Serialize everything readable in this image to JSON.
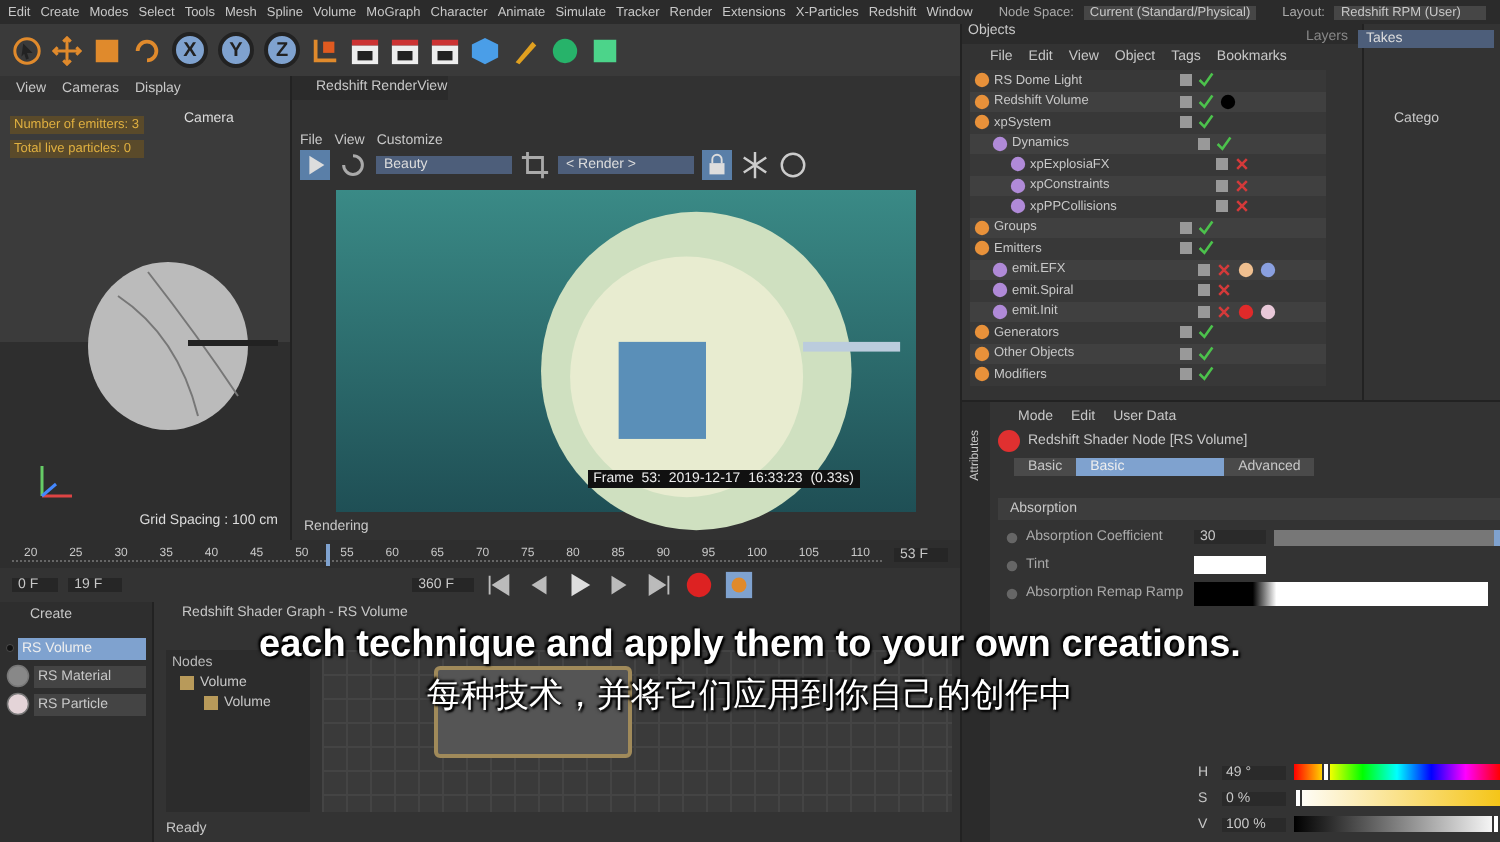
{
  "menubar": {
    "items": [
      "Edit",
      "Create",
      "Modes",
      "Select",
      "Tools",
      "Mesh",
      "Spline",
      "Volume",
      "MoGraph",
      "Character",
      "Animate",
      "Simulate",
      "Tracker",
      "Render",
      "Extensions",
      "X-Particles",
      "Redshift",
      "Window"
    ],
    "node_space_label": "Node Space:",
    "node_space_value": "Current (Standard/Physical)",
    "layout_label": "Layout:",
    "layout_value": "Redshift RPM (User)"
  },
  "toolbar": {
    "axis_buttons": [
      {
        "label": "X",
        "on": true
      },
      {
        "label": "Y",
        "on": true
      },
      {
        "label": "Z",
        "on": true
      }
    ]
  },
  "viewport": {
    "menu": [
      "View",
      "Cameras",
      "Display"
    ],
    "hud": [
      "Number of emitters: 3",
      "Total live particles: 0"
    ],
    "camera_label": "Camera",
    "grid_spacing": "Grid Spacing : 100 cm"
  },
  "render_view": {
    "title": "Redshift RenderView",
    "menu": [
      "File",
      "View",
      "Customize"
    ],
    "aov": "Beauty",
    "camera": "< Render >",
    "frame_info": "Frame  53:  2019-12-17  16:33:23  (0.33s)",
    "status": "Rendering"
  },
  "timeline": {
    "ticks": [
      "20",
      "25",
      "30",
      "35",
      "40",
      "45",
      "50",
      "55",
      "60",
      "65",
      "70",
      "75",
      "80",
      "85",
      "90",
      "95",
      "100",
      "105",
      "110"
    ],
    "playhead": {
      "level": 0.36
    },
    "current_frame": "53 F",
    "start": "0 F",
    "current": "19 F",
    "end": "360 F"
  },
  "create_panel": {
    "title": "Create",
    "items": [
      {
        "label": "RS Volume",
        "selected": true
      },
      {
        "label": "RS Material",
        "selected": false
      },
      {
        "label": "RS Particle",
        "selected": false
      }
    ]
  },
  "shader_graph": {
    "title": "Redshift Shader Graph - RS Volume",
    "nodes_title": "Nodes",
    "tree": [
      {
        "label": "Volume",
        "children": [
          {
            "label": "Volume"
          }
        ]
      }
    ],
    "status": "Ready"
  },
  "objects": {
    "title": "Objects",
    "menu": [
      "File",
      "Edit",
      "View",
      "Object",
      "Tags",
      "Bookmarks"
    ],
    "tree": [
      {
        "label": "RS Dome Light",
        "enabled": true
      },
      {
        "label": "Redshift Volume",
        "enabled": true,
        "tags": [
          {
            "color": "#000000"
          }
        ]
      },
      {
        "label": "xpSystem",
        "enabled": true,
        "children": [
          {
            "label": "Dynamics",
            "enabled": true,
            "children": [
              {
                "label": "xpExplosiaFX",
                "enabled": false
              },
              {
                "label": "xpConstraints",
                "enabled": false
              },
              {
                "label": "xpPPCollisions",
                "enabled": false
              }
            ]
          }
        ]
      },
      {
        "label": "Groups",
        "enabled": true
      },
      {
        "label": "Emitters",
        "enabled": true,
        "children": [
          {
            "label": "emit.EFX",
            "enabled": false,
            "tags": [
              {
                "color": "#f0c090"
              },
              {
                "color": "#8aa0e0"
              }
            ]
          },
          {
            "label": "emit.Spiral",
            "enabled": false
          },
          {
            "label": "emit.Init",
            "enabled": false,
            "tags": [
              {
                "color": "#e02a2a"
              },
              {
                "color": "#e8c8d8"
              }
            ]
          }
        ]
      },
      {
        "label": "Generators",
        "enabled": true
      },
      {
        "label": "Other Objects",
        "enabled": true
      },
      {
        "label": "Modifiers",
        "enabled": true
      }
    ]
  },
  "side_tabs": [
    {
      "label": "Layers",
      "selected": false
    },
    {
      "label": "Takes",
      "selected": true
    }
  ],
  "side_category": "Catego",
  "attributes": {
    "side_label": "Attributes",
    "menu": [
      "Mode",
      "Edit",
      "User Data"
    ],
    "node_title": "Redshift Shader Node [RS Volume]",
    "tabs": [
      {
        "label": "Basic",
        "selected": false
      },
      {
        "label": "Basic",
        "selected": true
      },
      {
        "label": "Advanced",
        "selected": false
      }
    ],
    "section": "Absorption",
    "fields": [
      {
        "label": "Absorption Coefficient",
        "kind": "number",
        "value": "30",
        "level": 0.97
      },
      {
        "label": "Tint",
        "kind": "color"
      },
      {
        "label": "Absorption Remap Ramp",
        "kind": "ramp"
      }
    ],
    "hsv": [
      {
        "label": "H",
        "value": "49 °",
        "kind": "hue",
        "level": 0.14
      },
      {
        "label": "S",
        "value": "0 %",
        "kind": "sat",
        "level": 0
      },
      {
        "label": "V",
        "value": "100 %",
        "kind": "val",
        "level": 1
      }
    ]
  },
  "subtitles": {
    "english": "each technique and apply them to your own creations.",
    "chinese": "每种技术，并将它们应用到你自己的创作中"
  }
}
